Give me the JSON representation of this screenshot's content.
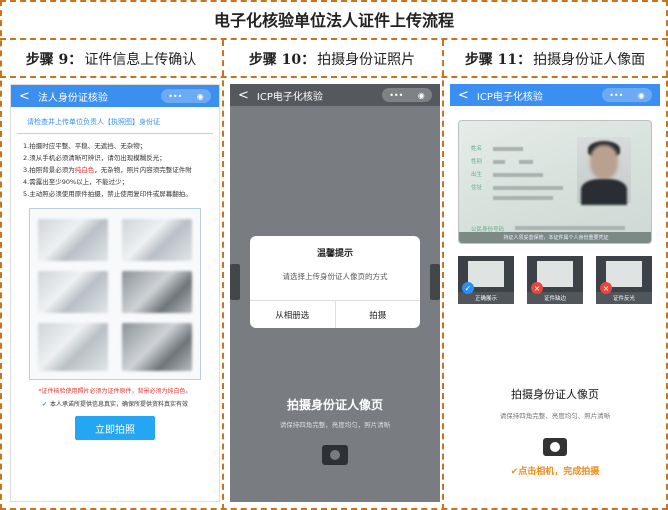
{
  "title": "电子化核验单位法人证件上传流程",
  "steps": [
    {
      "num": "步骤 9：",
      "label": "证件信息上传确认"
    },
    {
      "num": "步骤 10：",
      "label": "拍摄身份证照片"
    },
    {
      "num": "步骤 11：",
      "label": "拍摄身份证人像面"
    }
  ],
  "common": {
    "back": "<",
    "more": "•••",
    "target": "◉"
  },
  "panel1": {
    "bar_title": "法人身份证核验",
    "heading": "请检查并上传单位负责人【执照图】身份证",
    "rules": [
      "1.拍摄时应平整、平稳、无遮挡、无杂物；",
      "2.须从手机必须清晰可辨识，请勿出现模糊反光；",
      "3.拍照背景必须为纯白色，无杂物，照片内容须完整证件附",
      "4.需露出至少90%以上，不能过少；",
      "5.主动照必须使用原件拍摄，禁止使用复印件或屏幕翻拍。"
    ],
    "rule_highlight": "纯白色",
    "warning": "*证件核验使用照片必须为证件原件，背景必须为纯白色。",
    "agree": "本人承诺所提供信息真实，确保所提供资料真实有效",
    "button": "立即拍照"
  },
  "panel2": {
    "bar_title": "ICP电子化核验",
    "dialog_title": "温馨提示",
    "dialog_msg": "请选择上传身份证人像页的方式",
    "action_album": "从相册选",
    "action_camera": "拍摄",
    "bottom_title": "拍摄身份证人像页",
    "bottom_sub": "请保持四角完整，亮度均匀，照片清晰"
  },
  "panel3": {
    "bar_title": "ICP电子化核验",
    "id_labels": [
      "姓名",
      "性别",
      "出生",
      "住址"
    ],
    "id_number_label": "公民身份号码",
    "id_footer": "持证人须妥善保管，本证件属个人身份重要凭证",
    "thumbs": [
      {
        "caption": "正确展示",
        "badge": "✓",
        "color": "#2c8ef0"
      },
      {
        "caption": "证件缺边",
        "badge": "×",
        "color": "#e8463a"
      },
      {
        "caption": "证件反光",
        "badge": "×",
        "color": "#e8463a"
      }
    ],
    "bottom_title": "拍摄身份证人像页",
    "bottom_sub": "请保持四角完整、亮度均匀、照片清晰",
    "hint": "✔点击相机，完成拍摄"
  }
}
